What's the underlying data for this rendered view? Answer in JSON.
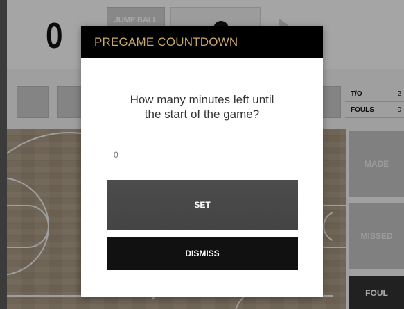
{
  "scoreboard": {
    "home_score": "0",
    "jump_ball_label": "JUMP BALL"
  },
  "stats": [
    {
      "label": "T/O",
      "value": "2"
    },
    {
      "label": "FOULS",
      "value": "0"
    }
  ],
  "actions": {
    "made_label": "MADE",
    "missed_label": "MISSED",
    "foul_label": "FOUL"
  },
  "modal": {
    "title": "PREGAME COUNTDOWN",
    "question": "How many minutes left until the start of the game?",
    "input_value": "",
    "input_placeholder": "0",
    "set_label": "SET",
    "dismiss_label": "DISMISS"
  },
  "colors": {
    "modal_title": "#c9a86a",
    "modal_header_bg": "#000000",
    "foul_bg": "#333333"
  }
}
